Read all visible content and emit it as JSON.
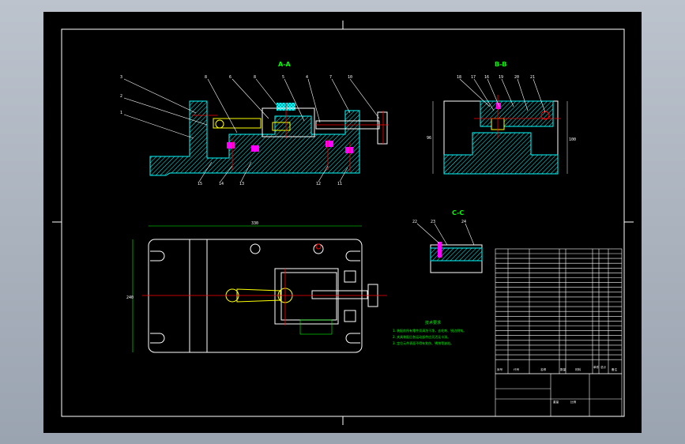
{
  "drawing": {
    "views": {
      "section_a": "A-A",
      "section_b": "B-B",
      "section_c": "C-C"
    },
    "balloons_a": [
      "3",
      "2",
      "1",
      "8",
      "6",
      "8",
      "5",
      "4",
      "7",
      "10",
      "15",
      "14",
      "13",
      "12",
      "11"
    ],
    "balloons_b": [
      "18",
      "17",
      "16",
      "19",
      "20",
      "21"
    ],
    "balloons_c": [
      "22",
      "23",
      "24"
    ],
    "dimensions": {
      "overall_length": "330",
      "height_b": "96",
      "width_plan": "240",
      "height_b2": "100"
    },
    "notes_title": "技术要求",
    "notes": [
      "1. 装配前所有零件须清洗干净，去毛刺、锐边倒钝。",
      "2. 夹具装配后各运动部件应灵活无卡滞。",
      "3. 定位元件表面不得有划伤、锈蚀等缺陷。"
    ],
    "title_block": {
      "headers": [
        "序号",
        "代号",
        "名称",
        "数量",
        "材料",
        "单件",
        "总计",
        "备注"
      ],
      "weight_label": "重量",
      "scale_label": "比例"
    }
  },
  "colors": {
    "background": "#000000",
    "outline": "#ffffff",
    "hatch": "#00ffff",
    "center": "#ff0000",
    "part": "#ffff00",
    "bolt": "#ff00ff",
    "text_green": "#00ff00"
  }
}
